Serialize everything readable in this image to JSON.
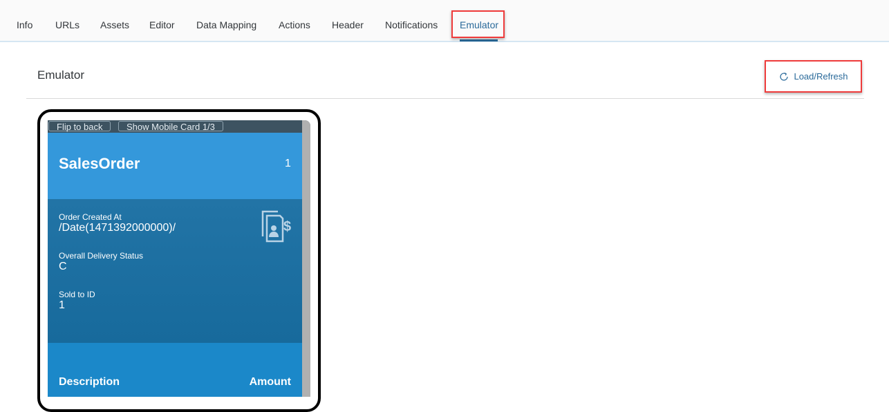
{
  "tabs": [
    {
      "label": "Info"
    },
    {
      "label": "URLs"
    },
    {
      "label": "Assets"
    },
    {
      "label": "Editor"
    },
    {
      "label": "Data Mapping"
    },
    {
      "label": "Actions"
    },
    {
      "label": "Header"
    },
    {
      "label": "Notifications"
    },
    {
      "label": "Emulator",
      "active": true
    }
  ],
  "section": {
    "title": "Emulator",
    "refresh_label": "Load/Refresh",
    "refresh_icon": "refresh-icon"
  },
  "emulator": {
    "flip_label": "Flip to back",
    "show_mobile_label": "Show Mobile Card 1/3",
    "card": {
      "title": "SalesOrder",
      "count": "1",
      "icon": "sales-order-document-dollar-icon",
      "fields": [
        {
          "label": "Order Created At",
          "value": "/Date(1471392000000)/"
        },
        {
          "label": "Overall Delivery Status",
          "value": "C"
        },
        {
          "label": "Sold to ID",
          "value": "1"
        }
      ],
      "columns": [
        "Description",
        "Amount"
      ]
    }
  },
  "colors": {
    "accent": "#2a6a9a",
    "highlight": "#ef3b3b",
    "card_header": "#3498db",
    "card_body": "#2274a6",
    "card_footer": "#1b88c9"
  }
}
